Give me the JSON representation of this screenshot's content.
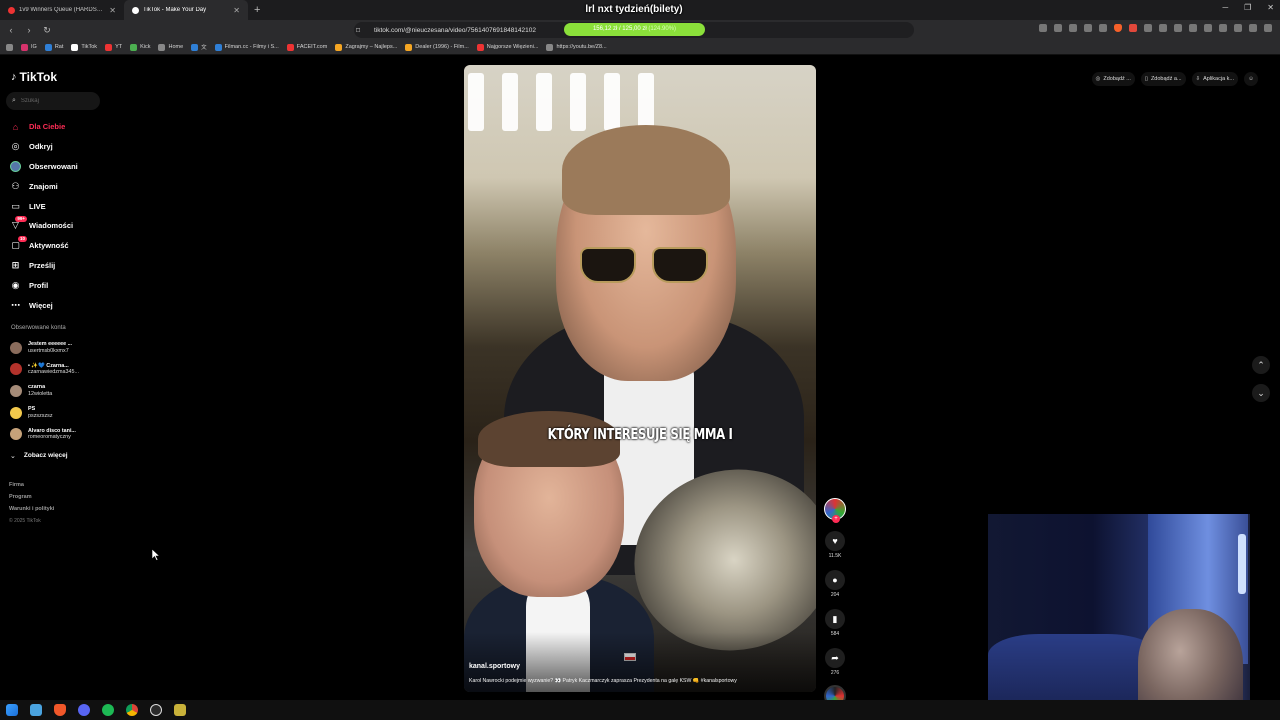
{
  "browser": {
    "tabs": [
      {
        "title": "1v9 Winners Queue (HARDSTYLE...",
        "active": false
      },
      {
        "title": "TikTok - Make Your Day",
        "active": true
      }
    ],
    "url": "tiktok.com/@nieuczesana/video/7561407691848142102",
    "bookmarks": [
      "IG",
      "Rat",
      "TikTok",
      "YT",
      "Kick",
      "Home",
      "文",
      "Filman.cc - Filmy i S...",
      "FACEIT.com",
      "Zagrajmy – Najleps...",
      "Dealer (1996) - Film...",
      "Najgorsze Więzieni...",
      "https://youtu.be/Z8..."
    ]
  },
  "stream_overlay": {
    "banner": "lrl nxt tydzień(bilety)",
    "goal_text": "156,12 zł / 125,00 zł",
    "goal_percent": "(124.90%)",
    "goal_fraction": 1.0
  },
  "tiktok": {
    "logo": "TikTok",
    "search_placeholder": "Szukaj",
    "menu": [
      {
        "label": "Dla Ciebie",
        "icon": "home-icon",
        "active": true
      },
      {
        "label": "Odkryj",
        "icon": "compass-icon"
      },
      {
        "label": "Obserwowani",
        "icon": "following-avatar-icon"
      },
      {
        "label": "Znajomi",
        "icon": "friends-icon"
      },
      {
        "label": "LIVE",
        "icon": "live-icon"
      },
      {
        "label": "Wiadomości",
        "icon": "messages-icon",
        "badge": "99+"
      },
      {
        "label": "Aktywność",
        "icon": "activity-icon",
        "badge": "10"
      },
      {
        "label": "Prześlij",
        "icon": "upload-icon"
      },
      {
        "label": "Profil",
        "icon": "profile-icon"
      },
      {
        "label": "Więcej",
        "icon": "more-icon"
      }
    ],
    "followed_title": "Obserwowane konta",
    "followed": [
      {
        "name": "Jestem eeeeee ...",
        "handle": "usertmsb0kxmx7"
      },
      {
        "name": "• ✨💙 Czarna...",
        "handle": "czarnawiedzma345..."
      },
      {
        "name": "czarna",
        "handle": "12wioletta"
      },
      {
        "name": "PS",
        "handle": "pszszszsz"
      },
      {
        "name": "Alvaro disco tani...",
        "handle": "romeoromatyczny"
      }
    ],
    "see_more": "Zobacz więcej",
    "footer": [
      "Firma",
      "Program",
      "Warunki i polityki"
    ],
    "copyright": "© 2025 TikTok",
    "top_right": [
      "Zdobądź ...",
      "Zdobądź a...",
      "Aplikacja k..."
    ]
  },
  "video": {
    "caption": "KTÓRY INTERESUJE SIĘ MMA I",
    "author": "kanal.sportowy",
    "description": "Karol Nawrocki podejmie wyzwanie? 👀 Patryk Kaczmarczyk zaprasza Prezydenta na galę KSW 👊 #kanalsportowy",
    "likes": "11.5K",
    "comments": "204",
    "saves": "584",
    "shares": "276"
  }
}
